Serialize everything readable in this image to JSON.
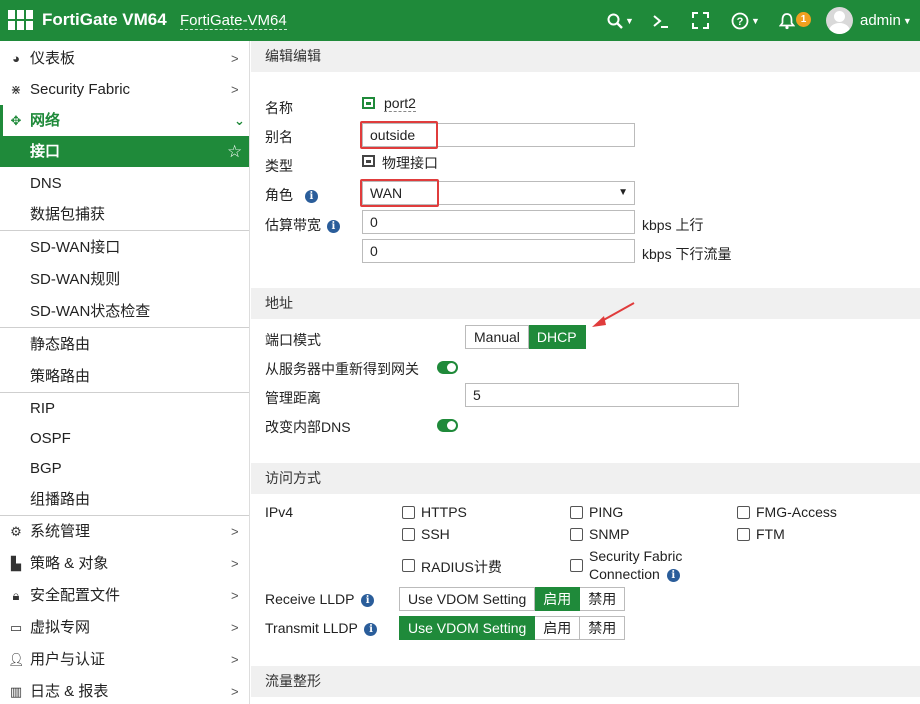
{
  "header": {
    "brand": "FortiGate VM64",
    "hostname": "FortiGate-VM64",
    "search_icon": "search-icon",
    "cli_icon": "terminal-icon",
    "fullscreen_icon": "fullscreen-icon",
    "help_icon": "help-icon",
    "bell_icon": "bell-icon",
    "notification_count": "1",
    "username": "admin",
    "accent_color": "#1f8a3a"
  },
  "sidebar": {
    "items": [
      {
        "label": "仪表板",
        "icon": "dashboard-icon"
      },
      {
        "label": "Security Fabric",
        "icon": "security-fabric-icon"
      },
      {
        "label": "网络",
        "icon": "network-icon"
      },
      {
        "label": "接口"
      },
      {
        "label": "DNS"
      },
      {
        "label": "数据包捕获"
      },
      {
        "label": "SD-WAN接口"
      },
      {
        "label": "SD-WAN规则"
      },
      {
        "label": "SD-WAN状态检查"
      },
      {
        "label": "静态路由"
      },
      {
        "label": "策略路由"
      },
      {
        "label": "RIP"
      },
      {
        "label": "OSPF"
      },
      {
        "label": "BGP"
      },
      {
        "label": "组播路由"
      },
      {
        "label": "系统管理",
        "icon": "gear-icon"
      },
      {
        "label": "策略 & 对象",
        "icon": "policy-icon"
      },
      {
        "label": "安全配置文件",
        "icon": "lock-icon"
      },
      {
        "label": "虚拟专网",
        "icon": "vpn-icon"
      },
      {
        "label": "用户与认证",
        "icon": "user-icon"
      },
      {
        "label": "日志 & 报表",
        "icon": "chart-icon"
      }
    ]
  },
  "edit": {
    "section_title": "编辑编辑",
    "name_label": "名称",
    "name_value": "port2",
    "alias_label": "别名",
    "alias_value": "outside",
    "type_label": "类型",
    "type_value": "物理接口",
    "role_label": "角色",
    "role_value": "WAN",
    "bandwidth_label": "估算带宽",
    "upstream_value": "0",
    "upstream_unit": "kbps 上行",
    "downstream_value": "0",
    "downstream_unit": "kbps 下行流量"
  },
  "address": {
    "section_title": "地址",
    "mode_label": "端口模式",
    "mode_options": [
      "Manual",
      "DHCP"
    ],
    "mode_selected": "DHCP",
    "gateway_label": "从服务器中重新得到网关",
    "distance_label": "管理距离",
    "distance_value": "5",
    "dns_label": "改变内部DNS"
  },
  "access": {
    "section_title": "访问方式",
    "ipv4_label": "IPv4",
    "options": [
      "HTTPS",
      "PING",
      "FMG-Access",
      "SSH",
      "SNMP",
      "FTM",
      "RADIUS计费",
      "Security Fabric",
      "Connection"
    ],
    "receive_lldp_label": "Receive LLDP",
    "transmit_lldp_label": "Transmit LLDP",
    "lldp_options": [
      "Use VDOM Setting",
      "启用",
      "禁用"
    ],
    "receive_selected": "启用",
    "transmit_selected": "Use VDOM Setting"
  },
  "traffic": {
    "section_title": "流量整形"
  }
}
